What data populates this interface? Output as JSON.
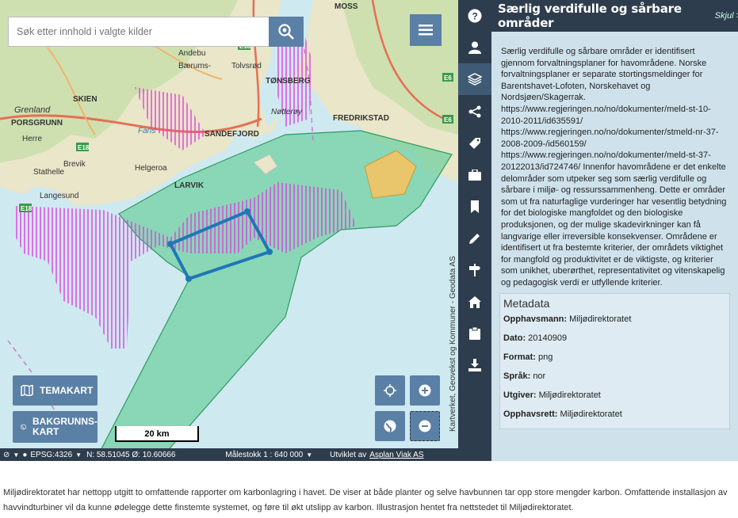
{
  "search": {
    "placeholder": "Søk etter innhold i valgte kilder"
  },
  "icons": {
    "search": "search-gear-icon",
    "menu": "hamburger-icon"
  },
  "map": {
    "places": [
      "MOSS",
      "Andebu",
      "Bærums-",
      "Tolvsrød",
      "TØNSBERG",
      "SKIEN",
      "Grenland",
      "PORSGRUNN",
      "Nøtterøy",
      "FREDRIKSTAD",
      "Herre",
      "SANDEFJORD",
      "Faris",
      "Stathelle",
      "Brevik",
      "Helgeroa",
      "LARVIK",
      "Langesund"
    ],
    "road_badges": [
      "E18",
      "E6",
      "E18",
      "E6",
      "E18"
    ],
    "scale_label": "20 km",
    "attribution": "Kartverket, Geovekst og Kommuner - Geodata AS"
  },
  "buttons": {
    "temakart": "TEMAKART",
    "bakgrunnskart_1": "BAKGRUNNS-",
    "bakgrunnskart_2": "KART"
  },
  "statusbar": {
    "crs": "EPSG:4326",
    "coords": "N: 58.51045 Ø: 10.60666",
    "scale": "Målestokk 1 : 640 000",
    "developed_by": "Utviklet av",
    "developer": "Asplan Viak AS"
  },
  "rail": [
    "question-icon",
    "user-icon",
    "layers-icon",
    "share-icon",
    "tag-icon",
    "briefcase-icon",
    "bookmark-icon",
    "pencil-icon",
    "signpost-icon",
    "home-icon",
    "clipboard-icon",
    "download-icon"
  ],
  "panel": {
    "title": "Særlig verdifulle og sårbare områder",
    "skjul": "Skjul >",
    "description": "Særlig verdifulle og sårbare områder er identifisert gjennom forvaltningsplaner for havområdene. Norske forvaltningsplaner er separate stortingsmeldinger for Barentshavet-Lofoten, Norskehavet og Nordsjøen/Skagerrak. https://www.regjeringen.no/no/dokumenter/meld-st-10-2010-2011/id635591/ https://www.regjeringen.no/no/dokumenter/stmeld-nr-37-2008-2009-/id560159/ https://www.regjeringen.no/no/dokumenter/meld-st-37-20122013/id724746/ Innenfor havområdene er det enkelte delområder som utpeker seg som særlig verdifulle og sårbare i miljø- og ressurssammenheng. Dette er områder som ut fra naturfaglige vurderinger har vesentlig betydning for det biologiske mangfoldet og den biologiske produksjonen, og der mulige skadevirkninger kan få langvarige eller irreversible konsekvenser. Områdene er identifisert ut fra bestemte kriterier, der områdets viktighet for mangfold og produktivitet er de viktigste, og kriterier som unikhet, uberørthet, representativitet og vitenskapelig og pedagogisk verdi er utfyllende kriterier.",
    "metadata_heading": "Metadata",
    "metadata": [
      {
        "label": "Opphavsmann:",
        "value": "Miljødirektoratet"
      },
      {
        "label": "Dato:",
        "value": "20140909"
      },
      {
        "label": "Format:",
        "value": "png"
      },
      {
        "label": "Språk:",
        "value": "nor"
      },
      {
        "label": "Utgiver:",
        "value": "Miljødirektoratet"
      },
      {
        "label": "Opphavsrett:",
        "value": "Miljødirektoratet"
      }
    ]
  },
  "caption": "Miljødirektoratet har nettopp utgitt to omfattende rapporter om karbonlagring i havet. De viser at både planter og selve havbunnen tar opp store mengder karbon. Omfattende installasjon av havvindturbiner vil da kunne ødelegge dette finstemte systemet, og føre til økt utslipp av karbon. Illustrasjon hentet fra nettstedet til Miljødirektoratet."
}
